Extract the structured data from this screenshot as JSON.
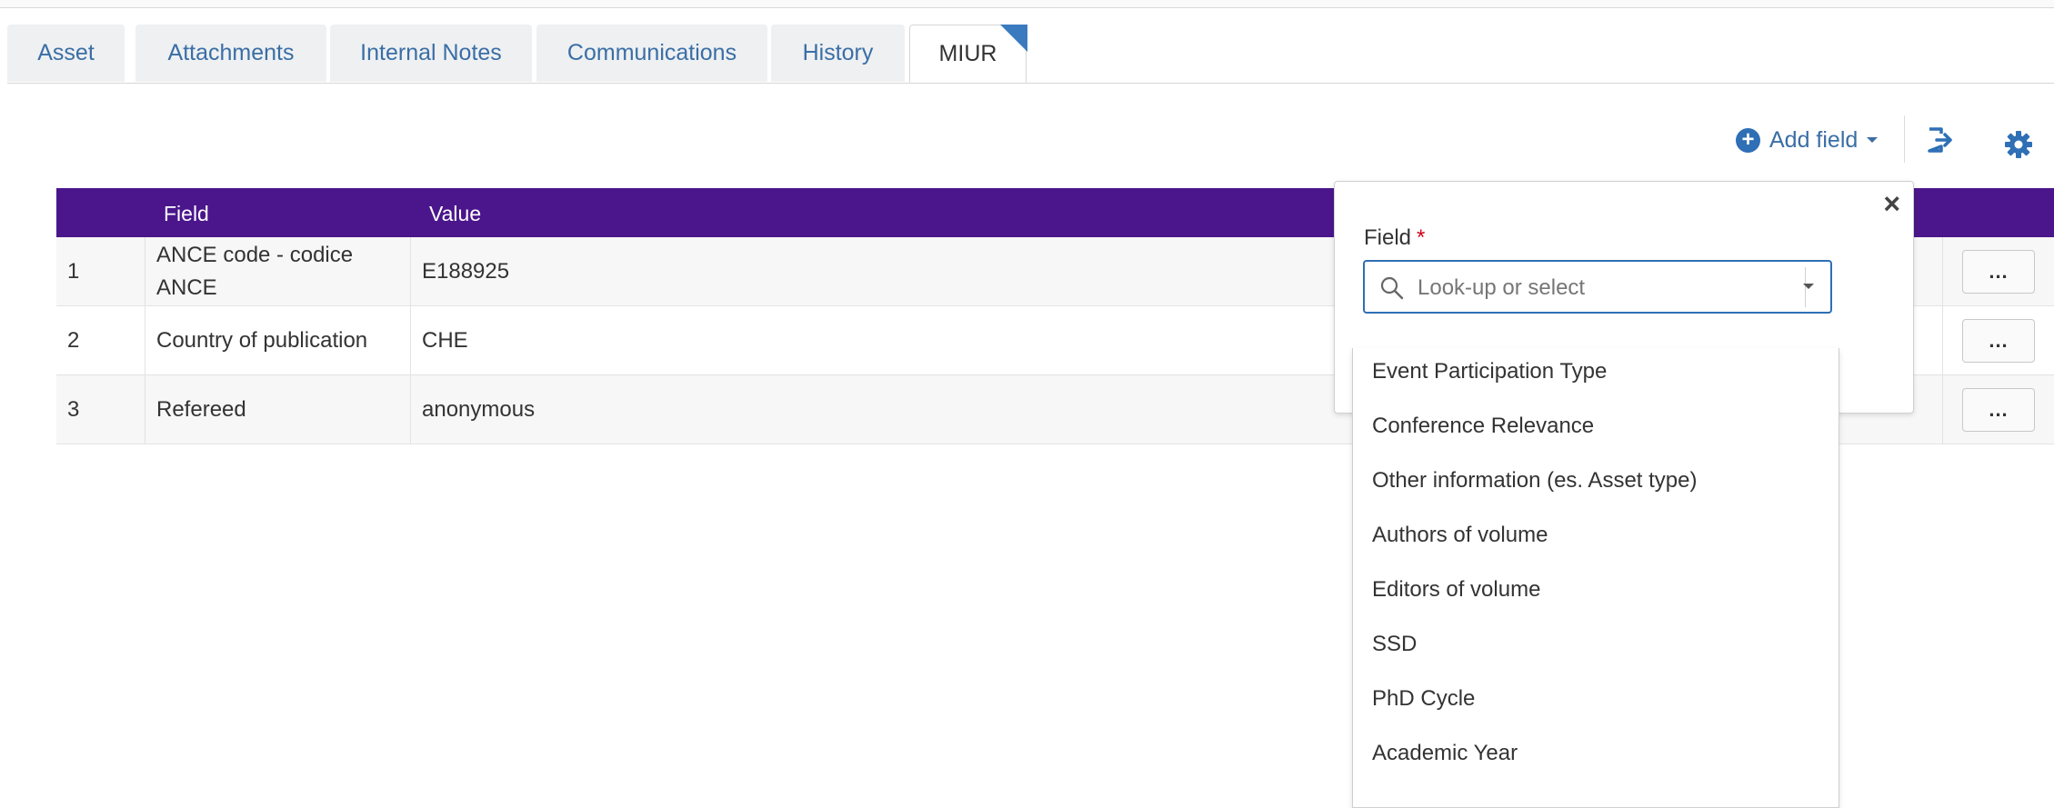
{
  "tabs": [
    {
      "label": "Asset"
    },
    {
      "label": "Attachments"
    },
    {
      "label": "Internal Notes"
    },
    {
      "label": "Communications"
    },
    {
      "label": "History"
    },
    {
      "label": "MIUR",
      "active": true
    }
  ],
  "toolbar": {
    "add_field_label": "Add field"
  },
  "table": {
    "headers": {
      "num": "",
      "field": "Field",
      "value": "Value"
    },
    "rows": [
      {
        "num": "1",
        "field": "ANCE code - codice ANCE",
        "value": "E188925",
        "action": "..."
      },
      {
        "num": "2",
        "field": "Country of publication",
        "value": "CHE",
        "action": "..."
      },
      {
        "num": "3",
        "field": "Refereed",
        "value": "anonymous",
        "action": "..."
      }
    ]
  },
  "popover": {
    "field_label": "Field",
    "required_marker": "*",
    "close": "×",
    "search_placeholder": "Look-up or select",
    "options": [
      "Event Participation Type",
      "Conference Relevance",
      "Other information (es. Asset type)",
      "Authors of volume",
      "Editors of volume",
      "SSD",
      "PhD Cycle",
      "Academic Year"
    ]
  },
  "colors": {
    "header_bg": "#4b168c",
    "link": "#3a6ea5",
    "accent": "#2e6fb5",
    "required": "#d0021b"
  }
}
